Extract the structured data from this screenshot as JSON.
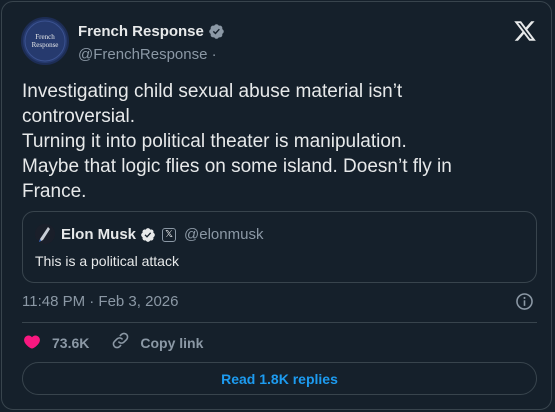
{
  "tweet": {
    "author": {
      "display_name": "French Response",
      "handle": "@FrenchResponse ·",
      "avatar_lines": [
        "French",
        "Response"
      ],
      "verified_icon": "verified-badge-icon"
    },
    "text_lines": [
      "Investigating child sexual abuse material isn’t",
      "controversial.",
      "Turning it into political theater is manipulation.",
      "Maybe that logic flies on some island. Doesn’t fly in",
      "France."
    ],
    "quote": {
      "display_name": "Elon Musk",
      "badge": "𝕏",
      "handle": "@elonmusk",
      "text": "This is a political attack"
    },
    "timestamp": "11:48 PM · Feb 3, 2026",
    "likes": "73.6K",
    "copy_link_label": "Copy link",
    "read_replies_label": "Read 1.8K replies"
  },
  "colors": {
    "background": "#15202b",
    "border": "#38444d",
    "text": "#e7e9ea",
    "muted": "#8b98a5",
    "accent": "#1d9bf0",
    "like": "#f91880",
    "verified": "#8b98a5"
  }
}
